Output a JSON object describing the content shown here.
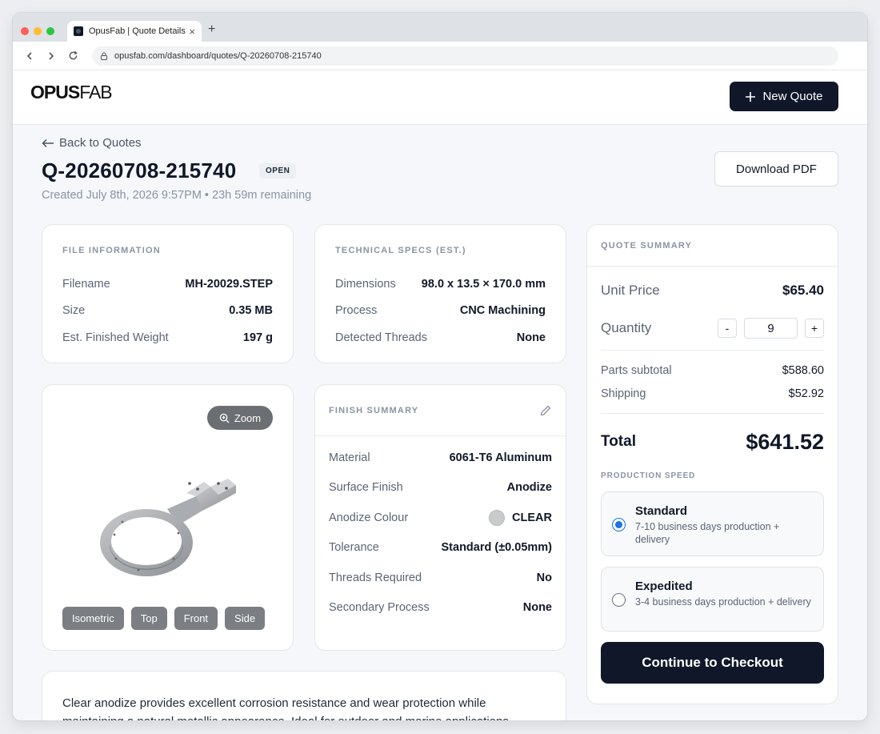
{
  "browser": {
    "tab_title": "OpusFab | Quote Details",
    "url": "opusfab.com/dashboard/quotes/Q-20260708-215740"
  },
  "header": {
    "logo_bold": "OPUS",
    "logo_light": "FAB",
    "new_quote_label": "New Quote"
  },
  "quote": {
    "back_label": "Back to Quotes",
    "id": "Q-20260708-215740",
    "status": "OPEN",
    "meta": "Created July 8th, 2026 9:57PM • 23h 59m remaining",
    "download_label": "Download PDF"
  },
  "file_info": {
    "title": "FILE INFORMATION",
    "rows": [
      {
        "label": "Filename",
        "value": "MH-20029.STEP"
      },
      {
        "label": "Size",
        "value": "0.35 MB"
      },
      {
        "label": "Est. Finished Weight",
        "value": "197 g"
      }
    ]
  },
  "tech_specs": {
    "title": "TECHNICAL SPECS (EST.)",
    "rows": [
      {
        "label": "Dimensions",
        "value": "98.0 x 13.5 × 170.0 mm"
      },
      {
        "label": "Process",
        "value": "CNC Machining"
      },
      {
        "label": "Detected Threads",
        "value": "None"
      }
    ]
  },
  "viewer": {
    "zoom_label": "Zoom",
    "views": [
      "Isometric",
      "Top",
      "Front",
      "Side"
    ]
  },
  "finish": {
    "title": "FINISH SUMMARY",
    "rows": [
      {
        "label": "Material",
        "value": "6061-T6 Aluminum"
      },
      {
        "label": "Surface Finish",
        "value": "Anodize"
      },
      {
        "label": "Anodize Colour",
        "value": "CLEAR"
      },
      {
        "label": "Tolerance",
        "value": "Standard (±0.05mm)"
      },
      {
        "label": "Threads Required",
        "value": "No"
      },
      {
        "label": "Secondary Process",
        "value": "None"
      }
    ],
    "swatch_color": "#c9cacc"
  },
  "description": "Clear anodize provides excellent corrosion resistance and wear protection while maintaining a natural metallic appearance. Ideal for outdoor and marine applications.",
  "summary": {
    "title": "QUOTE SUMMARY",
    "unit_price_label": "Unit Price",
    "unit_price": "$65.40",
    "quantity_label": "Quantity",
    "quantity": "9",
    "minus": "-",
    "plus": "+",
    "subtotal_label": "Parts subtotal",
    "subtotal": "$588.60",
    "shipping_label": "Shipping",
    "shipping": "$52.92",
    "total_label": "Total",
    "total": "$641.52",
    "speed_title": "PRODUCTION SPEED",
    "options": [
      {
        "name": "Standard",
        "desc": "7-10 business days production + delivery",
        "selected": true
      },
      {
        "name": "Expedited",
        "desc": "3-4 business days production + delivery",
        "selected": false
      }
    ],
    "checkout_label": "Continue to Checkout"
  },
  "colors": {
    "primary": "#0f1729",
    "radio_accent": "#1a73e8"
  }
}
